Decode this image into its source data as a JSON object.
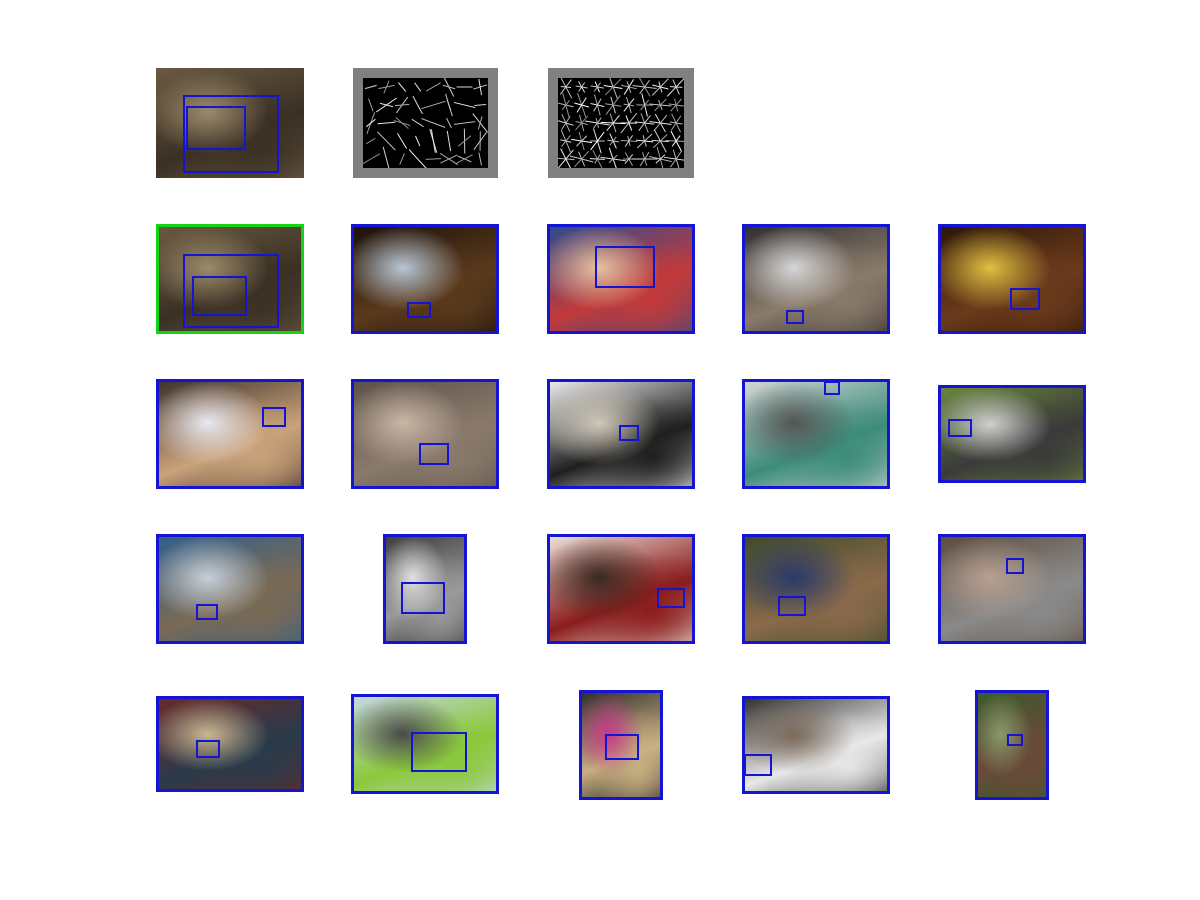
{
  "colors": {
    "detection_frame": "#1414d2",
    "query_frame": "#14d214",
    "hog_border": "#808080",
    "hog_background": "#000000"
  },
  "figure": {
    "query": {
      "palette": [
        "#6b5a43",
        "#3a3024",
        "#9c8a6a",
        "#2a3b7a"
      ]
    },
    "hog_templates": [
      {
        "name": "hog-template-a"
      },
      {
        "name": "hog-template-b"
      }
    ],
    "results": [
      {
        "palette": [
          "#6b5a43",
          "#3a3024",
          "#9c8a6a"
        ],
        "match": "correct"
      },
      {
        "palette": [
          "#1a0f08",
          "#5a3a1c",
          "#b7c6d4"
        ],
        "match": "false"
      },
      {
        "palette": [
          "#2a4c8f",
          "#c23a3a",
          "#e6c3a0"
        ],
        "match": "false"
      },
      {
        "palette": [
          "#2b2b2e",
          "#8a7a6a",
          "#d7d7d7"
        ],
        "match": "false"
      },
      {
        "palette": [
          "#2a1608",
          "#6b3a1c",
          "#e0c040"
        ],
        "match": "false"
      },
      {
        "palette": [
          "#3a2e28",
          "#c9a27a",
          "#e8e8ef"
        ],
        "match": "false"
      },
      {
        "palette": [
          "#5b5048",
          "#8a7a6c",
          "#c9b7a6"
        ],
        "match": "false"
      },
      {
        "palette": [
          "#f2f2f2",
          "#1f1f1f",
          "#d0c8b8"
        ],
        "match": "false"
      },
      {
        "palette": [
          "#d9d9d9",
          "#3c8c7a",
          "#555555"
        ],
        "match": "false"
      },
      {
        "palette": [
          "#6b8a3a",
          "#3a3a3a",
          "#d0d0d0"
        ],
        "match": "false"
      },
      {
        "palette": [
          "#2f5e8c",
          "#7a6a55",
          "#c7d0d8"
        ],
        "match": "false"
      },
      {
        "palette": [
          "#3a3a3a",
          "#9a9a9a",
          "#e0e0e0"
        ],
        "match": "false"
      },
      {
        "palette": [
          "#f0e8e0",
          "#8a1c1c",
          "#3a2a20"
        ],
        "match": "false"
      },
      {
        "palette": [
          "#3a4a2a",
          "#8a6a4a",
          "#2a3a6a"
        ],
        "match": "false"
      },
      {
        "palette": [
          "#5a4a3a",
          "#8a8a8a",
          "#b8a090"
        ],
        "match": "false"
      },
      {
        "palette": [
          "#6a2a2a",
          "#2a3a4a",
          "#c8b890"
        ],
        "match": "false"
      },
      {
        "palette": [
          "#c8d8e8",
          "#8ac83a",
          "#4a4a4a"
        ],
        "match": "false"
      },
      {
        "palette": [
          "#2a2a2a",
          "#c8b080",
          "#c83a8a"
        ],
        "match": "false"
      },
      {
        "palette": [
          "#2a2a2a",
          "#e8e8e8",
          "#7a6a5a"
        ],
        "match": "false"
      },
      {
        "palette": [
          "#3a5a2a",
          "#6a4a3a",
          "#8a9a6a"
        ],
        "match": "false"
      }
    ]
  }
}
